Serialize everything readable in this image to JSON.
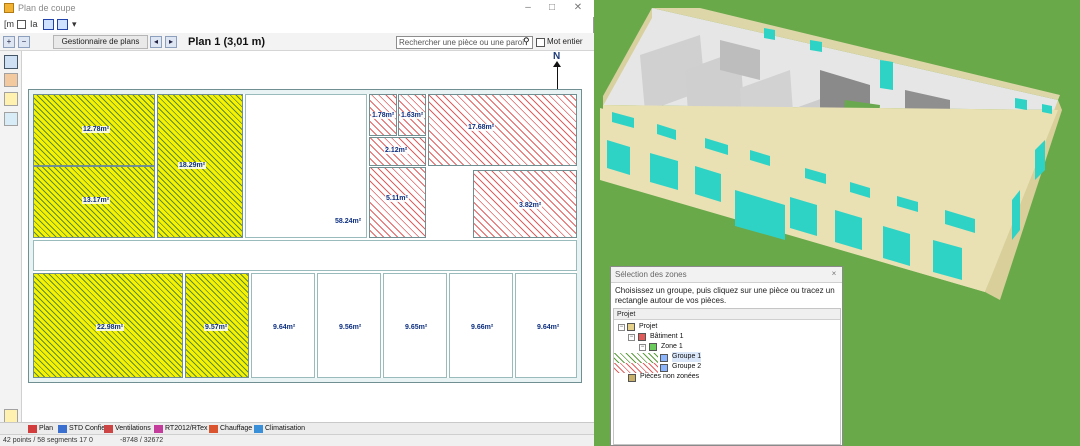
{
  "plan_window": {
    "title": "Plan de coupe",
    "toolbar_text": {
      "sym1": "[m",
      "sym2": "Ia",
      "sym3": "▾"
    },
    "gestion_label": "Gestionnaire de plans",
    "plan_title": "Plan 1 (3,01 m)",
    "search_placeholder": "Rechercher une pièce ou une paroi",
    "search_icon": "magnifier-icon",
    "mot_entier_label": "Mot entier",
    "north_label": "N"
  },
  "rooms": {
    "r1": "12.78m²",
    "r2": "18.29m²",
    "r3": "13.17m²",
    "r4": "1.78m²",
    "r5": "1.63m²",
    "r6": "17.68m²",
    "r7": "2.12m²",
    "r8": "5.11m²",
    "r9": "58.24m²",
    "r10": "3.82m²",
    "r11": "22.98m²",
    "r12": "9.57m²",
    "r13": "9.64m²",
    "r14": "9.56m²",
    "r15": "9.65m²",
    "r16": "9.66m²",
    "r17": "9.64m²"
  },
  "tabs": [
    {
      "label": "Plan",
      "color": "#d33c3c"
    },
    {
      "label": "STD Confie",
      "color": "#3a6fd0"
    },
    {
      "label": "Ventilations",
      "color": "#cc4444"
    },
    {
      "label": "RT2012/RTex",
      "color": "#c33b9b"
    },
    {
      "label": "Chauffage",
      "color": "#d9542f"
    },
    {
      "label": "Climatisation",
      "color": "#3a8fd9"
    }
  ],
  "status": {
    "left": "42 points / 58 segments 17 0",
    "coords": "-8748 / 32672"
  },
  "zones_dialog": {
    "title": "Sélection des zones",
    "close": "×",
    "instruction": "Choisissez un groupe, puis cliquez sur une pièce ou tracez un rectangle autour de vos pièces.",
    "tree_header": "Projet",
    "tree": {
      "projet": "Projet",
      "batiment": "Bâtiment 1",
      "zone": "Zone 1",
      "groupe1": "Groupe 1",
      "groupe2": "Groupe 2",
      "non_zonees": "Pièces non zonées"
    }
  },
  "colors": {
    "floor_yellow": "#f7f200",
    "hatch_red": "#e06060",
    "ground": "#69a94a",
    "facade": "#e9e1b4",
    "window": "#2fd3c6"
  }
}
